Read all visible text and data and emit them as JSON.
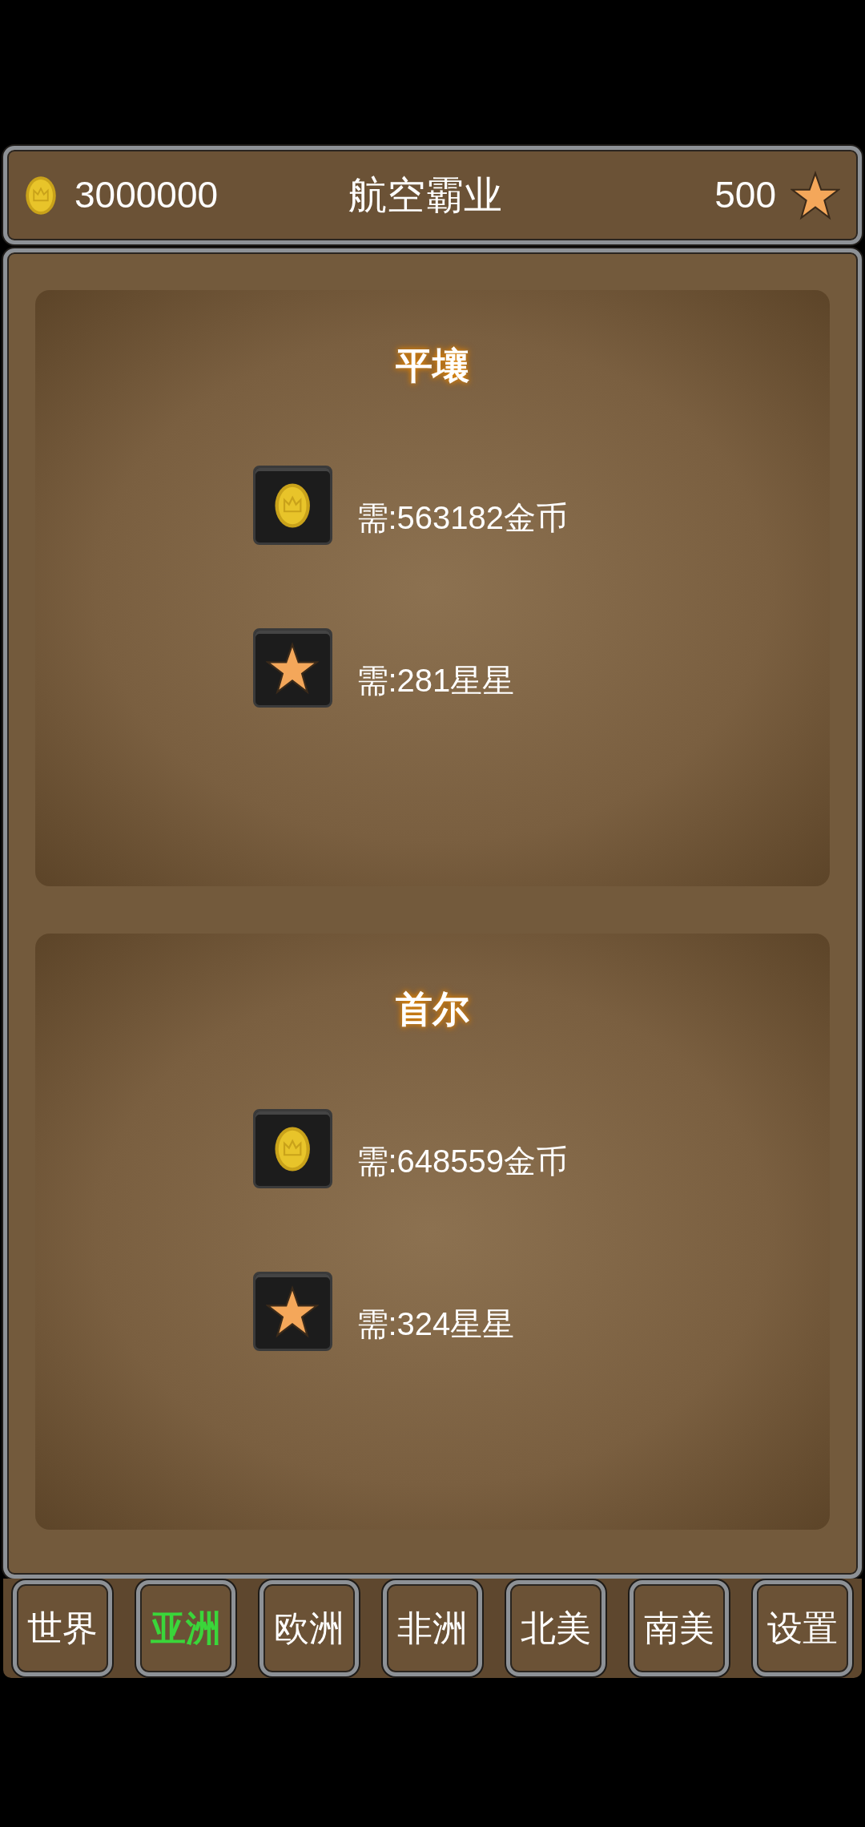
{
  "header": {
    "coins": "3000000",
    "title": "航空霸业",
    "stars": "500"
  },
  "cities": [
    {
      "name": "平壤",
      "requirements": [
        {
          "kind": "coin",
          "text": "需:563182金币"
        },
        {
          "kind": "star",
          "text": "需:281星星"
        }
      ]
    },
    {
      "name": "首尔",
      "requirements": [
        {
          "kind": "coin",
          "text": "需:648559金币"
        },
        {
          "kind": "star",
          "text": "需:324星星"
        }
      ]
    }
  ],
  "tabs": [
    {
      "label": "世界",
      "selected": false
    },
    {
      "label": "亚洲",
      "selected": true
    },
    {
      "label": "欧洲",
      "selected": false
    },
    {
      "label": "非洲",
      "selected": false
    },
    {
      "label": "北美",
      "selected": false
    },
    {
      "label": "南美",
      "selected": false
    },
    {
      "label": "设置",
      "selected": false
    }
  ]
}
